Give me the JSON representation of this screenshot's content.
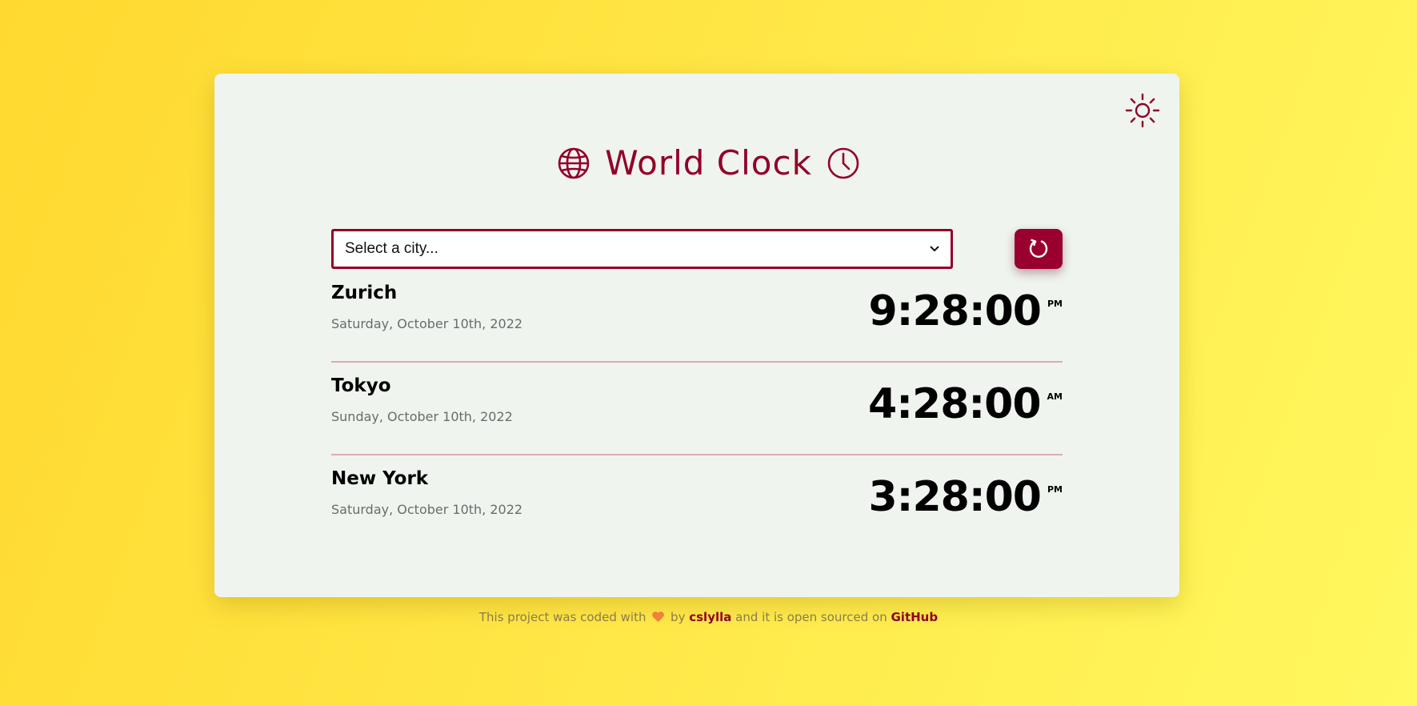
{
  "app": {
    "title": "World Clock",
    "icons": {
      "title_left": "globe-icon",
      "title_right": "clock-icon",
      "theme_toggle": "sun-icon",
      "refresh": "refresh-icon"
    },
    "colors": {
      "accent": "#920028",
      "card": "#eff4ef",
      "background_from": "#ffd92f",
      "background_to": "#fff85f",
      "divider": "#e1a9b4"
    }
  },
  "selector": {
    "placeholder": "Select a city..."
  },
  "cities": [
    {
      "name": "Zurich",
      "date": "Saturday, October 10th, 2022",
      "time": "9:28:00",
      "period": "PM"
    },
    {
      "name": "Tokyo",
      "date": "Sunday, October 10th, 2022",
      "time": "4:28:00",
      "period": "AM"
    },
    {
      "name": "New York",
      "date": "Saturday, October 10th, 2022",
      "time": "3:28:00",
      "period": "PM"
    }
  ],
  "footer": {
    "text_before": "This project was coded with",
    "text_by": "by",
    "author": "cslylla",
    "text_middle": "and it is open sourced on",
    "repo_link": "GitHub",
    "heart_icon": "heart-icon"
  }
}
